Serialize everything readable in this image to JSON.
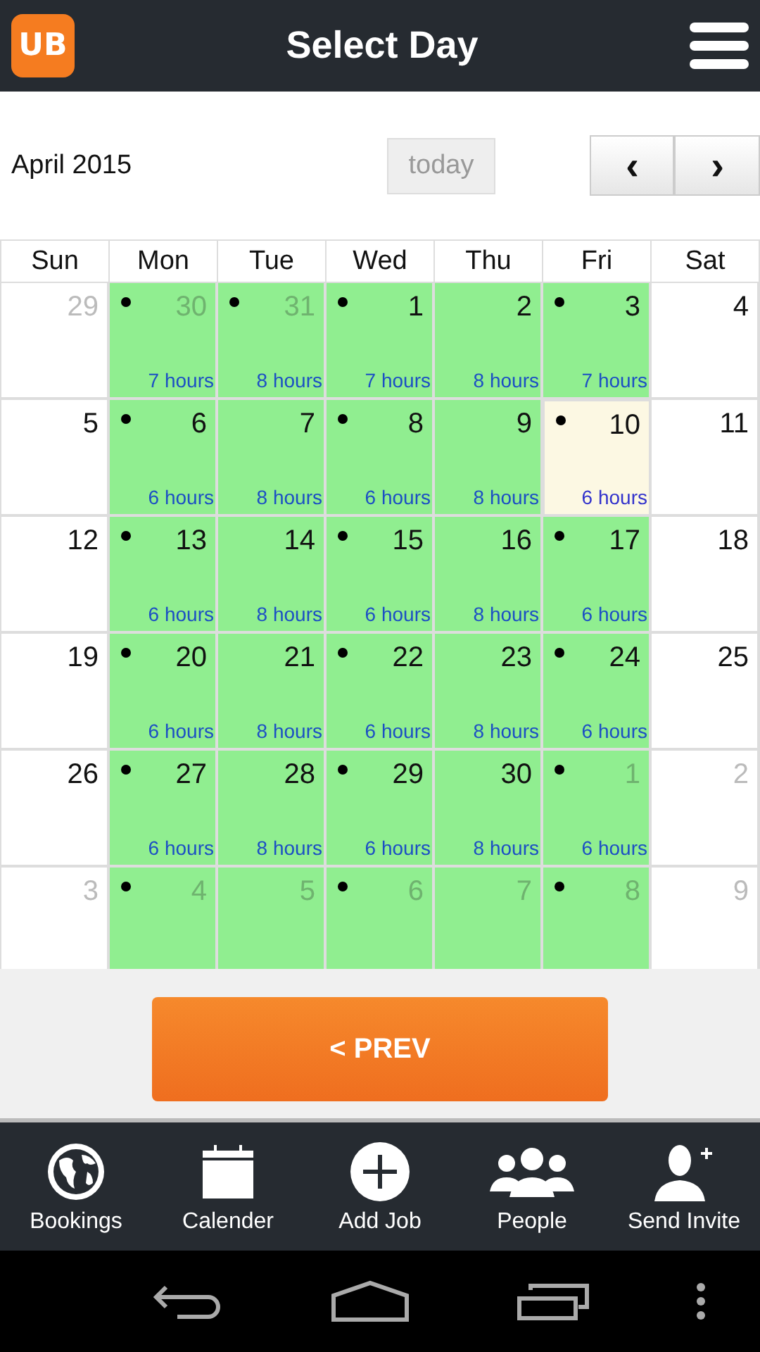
{
  "header": {
    "logo": "UB",
    "title": "Select Day"
  },
  "toolbar": {
    "month": "April 2015",
    "today_button": {
      "label": "today",
      "disabled": true
    },
    "prev": "‹",
    "next": "›"
  },
  "calendar": {
    "weekdays": [
      "Sun",
      "Mon",
      "Tue",
      "Wed",
      "Thu",
      "Fri",
      "Sat"
    ],
    "weeks": [
      [
        {
          "day": "29",
          "muted": true,
          "booked": false,
          "dot": false,
          "today": false
        },
        {
          "day": "30",
          "muted": true,
          "booked": true,
          "dot": true,
          "today": false,
          "hours": "7 hours"
        },
        {
          "day": "31",
          "muted": true,
          "booked": true,
          "dot": true,
          "today": false,
          "hours": "8 hours"
        },
        {
          "day": "1",
          "muted": false,
          "booked": true,
          "dot": true,
          "today": false,
          "hours": "7 hours"
        },
        {
          "day": "2",
          "muted": false,
          "booked": true,
          "dot": false,
          "today": false,
          "hours": "8 hours"
        },
        {
          "day": "3",
          "muted": false,
          "booked": true,
          "dot": true,
          "today": false,
          "hours": "7 hours"
        },
        {
          "day": "4",
          "muted": false,
          "booked": false,
          "dot": false,
          "today": false
        }
      ],
      [
        {
          "day": "5",
          "muted": false,
          "booked": false,
          "dot": false,
          "today": false
        },
        {
          "day": "6",
          "muted": false,
          "booked": true,
          "dot": true,
          "today": false,
          "hours": "6 hours"
        },
        {
          "day": "7",
          "muted": false,
          "booked": true,
          "dot": false,
          "today": false,
          "hours": "8 hours"
        },
        {
          "day": "8",
          "muted": false,
          "booked": true,
          "dot": true,
          "today": false,
          "hours": "6 hours"
        },
        {
          "day": "9",
          "muted": false,
          "booked": true,
          "dot": false,
          "today": false,
          "hours": "8 hours"
        },
        {
          "day": "10",
          "muted": false,
          "booked": true,
          "dot": true,
          "today": true,
          "hours": "6 hours"
        },
        {
          "day": "11",
          "muted": false,
          "booked": false,
          "dot": false,
          "today": false
        }
      ],
      [
        {
          "day": "12",
          "muted": false,
          "booked": false,
          "dot": false,
          "today": false
        },
        {
          "day": "13",
          "muted": false,
          "booked": true,
          "dot": true,
          "today": false,
          "hours": "6 hours"
        },
        {
          "day": "14",
          "muted": false,
          "booked": true,
          "dot": false,
          "today": false,
          "hours": "8 hours"
        },
        {
          "day": "15",
          "muted": false,
          "booked": true,
          "dot": true,
          "today": false,
          "hours": "6 hours"
        },
        {
          "day": "16",
          "muted": false,
          "booked": true,
          "dot": false,
          "today": false,
          "hours": "8 hours"
        },
        {
          "day": "17",
          "muted": false,
          "booked": true,
          "dot": true,
          "today": false,
          "hours": "6 hours"
        },
        {
          "day": "18",
          "muted": false,
          "booked": false,
          "dot": false,
          "today": false
        }
      ],
      [
        {
          "day": "19",
          "muted": false,
          "booked": false,
          "dot": false,
          "today": false
        },
        {
          "day": "20",
          "muted": false,
          "booked": true,
          "dot": true,
          "today": false,
          "hours": "6 hours"
        },
        {
          "day": "21",
          "muted": false,
          "booked": true,
          "dot": false,
          "today": false,
          "hours": "8 hours"
        },
        {
          "day": "22",
          "muted": false,
          "booked": true,
          "dot": true,
          "today": false,
          "hours": "6 hours"
        },
        {
          "day": "23",
          "muted": false,
          "booked": true,
          "dot": false,
          "today": false,
          "hours": "8 hours"
        },
        {
          "day": "24",
          "muted": false,
          "booked": true,
          "dot": true,
          "today": false,
          "hours": "6 hours"
        },
        {
          "day": "25",
          "muted": false,
          "booked": false,
          "dot": false,
          "today": false
        }
      ],
      [
        {
          "day": "26",
          "muted": false,
          "booked": false,
          "dot": false,
          "today": false
        },
        {
          "day": "27",
          "muted": false,
          "booked": true,
          "dot": true,
          "today": false,
          "hours": "6 hours"
        },
        {
          "day": "28",
          "muted": false,
          "booked": true,
          "dot": false,
          "today": false,
          "hours": "8 hours"
        },
        {
          "day": "29",
          "muted": false,
          "booked": true,
          "dot": true,
          "today": false,
          "hours": "6 hours"
        },
        {
          "day": "30",
          "muted": false,
          "booked": true,
          "dot": false,
          "today": false,
          "hours": "8 hours"
        },
        {
          "day": "1",
          "muted": true,
          "booked": true,
          "dot": true,
          "today": false,
          "hours": "6 hours"
        },
        {
          "day": "2",
          "muted": true,
          "booked": false,
          "dot": false,
          "today": false
        }
      ],
      [
        {
          "day": "3",
          "muted": true,
          "booked": false,
          "dot": false,
          "today": false
        },
        {
          "day": "4",
          "muted": true,
          "booked": true,
          "dot": true,
          "today": false
        },
        {
          "day": "5",
          "muted": true,
          "booked": true,
          "dot": false,
          "today": false
        },
        {
          "day": "6",
          "muted": true,
          "booked": true,
          "dot": true,
          "today": false
        },
        {
          "day": "7",
          "muted": true,
          "booked": true,
          "dot": false,
          "today": false
        },
        {
          "day": "8",
          "muted": true,
          "booked": true,
          "dot": true,
          "today": false
        },
        {
          "day": "9",
          "muted": true,
          "booked": false,
          "dot": false,
          "today": false
        }
      ]
    ]
  },
  "prev_button": "< PREV",
  "bottom_nav": [
    {
      "kind": "globe",
      "label": "Bookings"
    },
    {
      "kind": "calendar",
      "label": "Calender"
    },
    {
      "kind": "add",
      "label": "Add Job"
    },
    {
      "kind": "people",
      "label": "People"
    },
    {
      "kind": "invite",
      "label": "Send Invite"
    }
  ]
}
